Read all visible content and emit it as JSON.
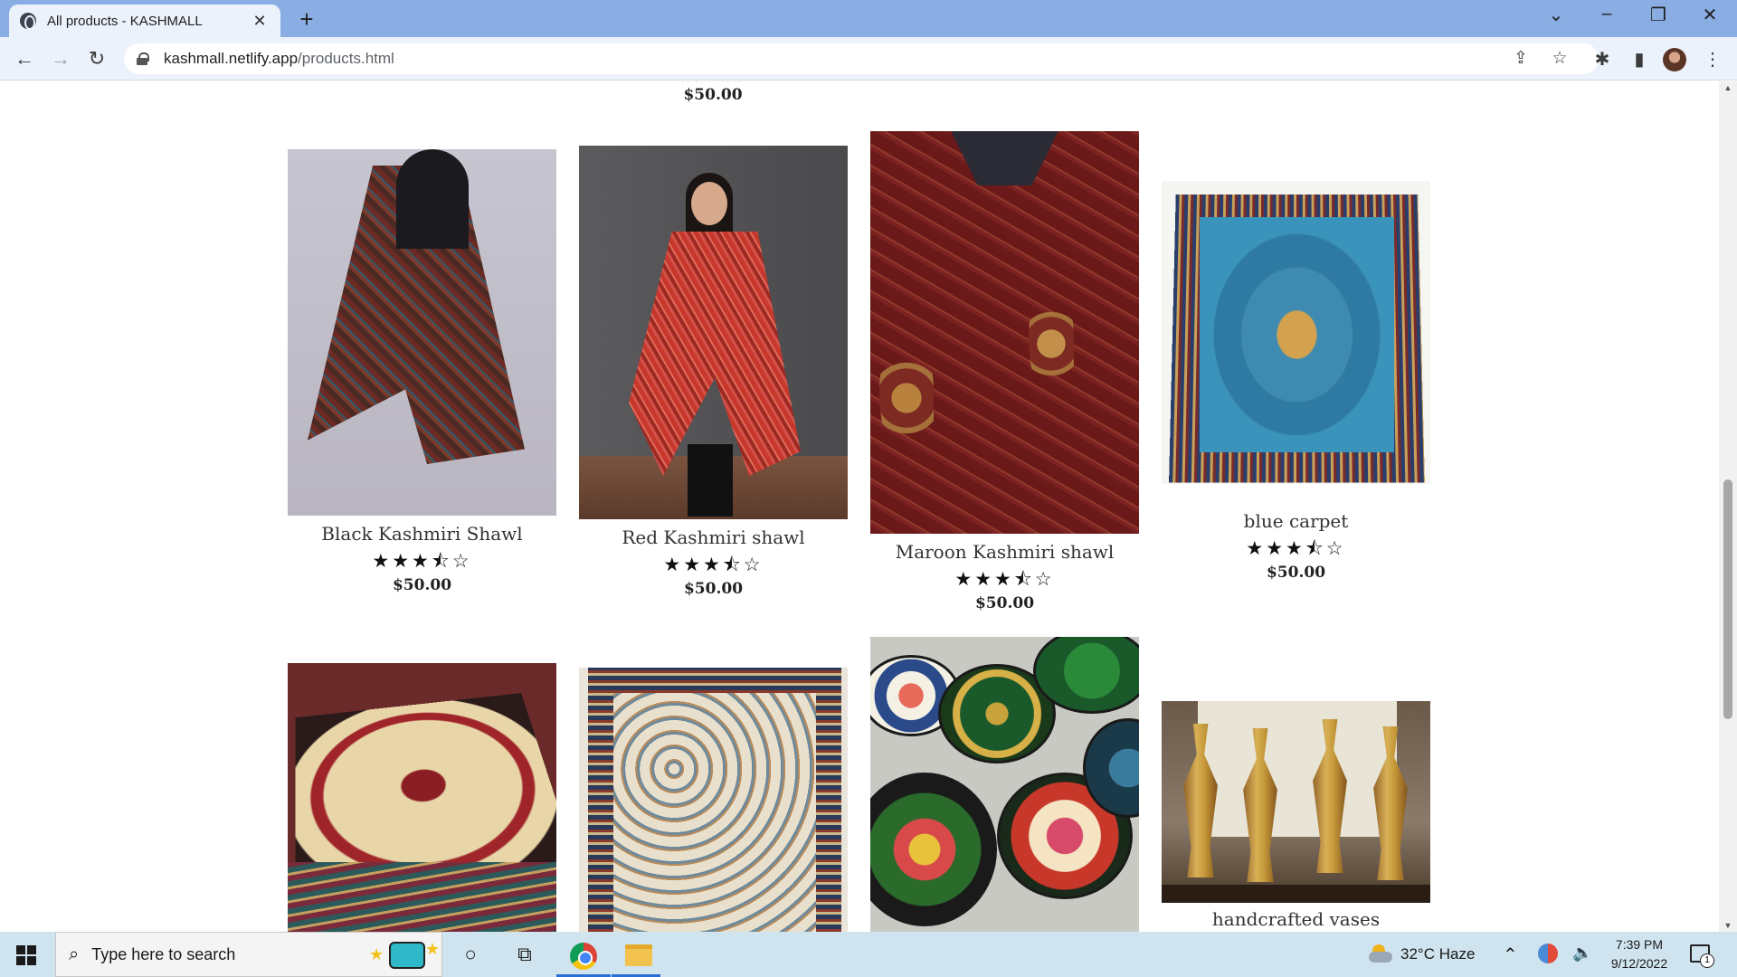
{
  "browser": {
    "tab_title": "All products - KASHMALL",
    "tab_close": "✕",
    "new_tab": "+",
    "url_host": "kashmall.netlify.app",
    "url_path": "/products.html",
    "window_controls": {
      "dropdown": "⌄",
      "minimize": "–",
      "restore": "❐",
      "close": "✕"
    },
    "nav": {
      "back": "←",
      "forward": "→",
      "reload": "↻"
    },
    "toolbar_icons": {
      "share": "⇪",
      "bookmark": "☆",
      "extensions": "✱",
      "sidebar": "▮",
      "menu": "⋮"
    }
  },
  "page": {
    "previous_row": {
      "stars": "☆☆☆☆☆",
      "price": "$50.00"
    },
    "products": [
      {
        "name": "Black Kashmiri Shawl",
        "rating": 3.5,
        "stars": "★★★⯪☆",
        "price": "$50.00",
        "image_icon": "shawl-image"
      },
      {
        "name": "Red Kashmiri shawl",
        "rating": 3.5,
        "stars": "★★★⯪☆",
        "price": "$50.00",
        "image_icon": "shawl-image"
      },
      {
        "name": "Maroon Kashmiri shawl",
        "rating": 3.5,
        "stars": "★★★⯪☆",
        "price": "$50.00",
        "image_icon": "shawl-image"
      },
      {
        "name": "blue carpet",
        "rating": 3.5,
        "stars": "★★★⯪☆",
        "price": "$50.00",
        "image_icon": "carpet-image"
      },
      {
        "name": "",
        "image_icon": "carpet-image"
      },
      {
        "name": "",
        "image_icon": "carpet-image"
      },
      {
        "name": "",
        "image_icon": "papier-mache-boxes-image"
      },
      {
        "name": "handcrafted vases",
        "image_icon": "vases-image"
      }
    ]
  },
  "taskbar": {
    "search_placeholder": "Type here to search",
    "task_view": "⧉",
    "cortana": "○",
    "weather": "32°C  Haze",
    "tray_chevron": "⌃",
    "volume": "🔈",
    "time": "7:39 PM",
    "date": "9/12/2022",
    "notification_count": "1"
  }
}
